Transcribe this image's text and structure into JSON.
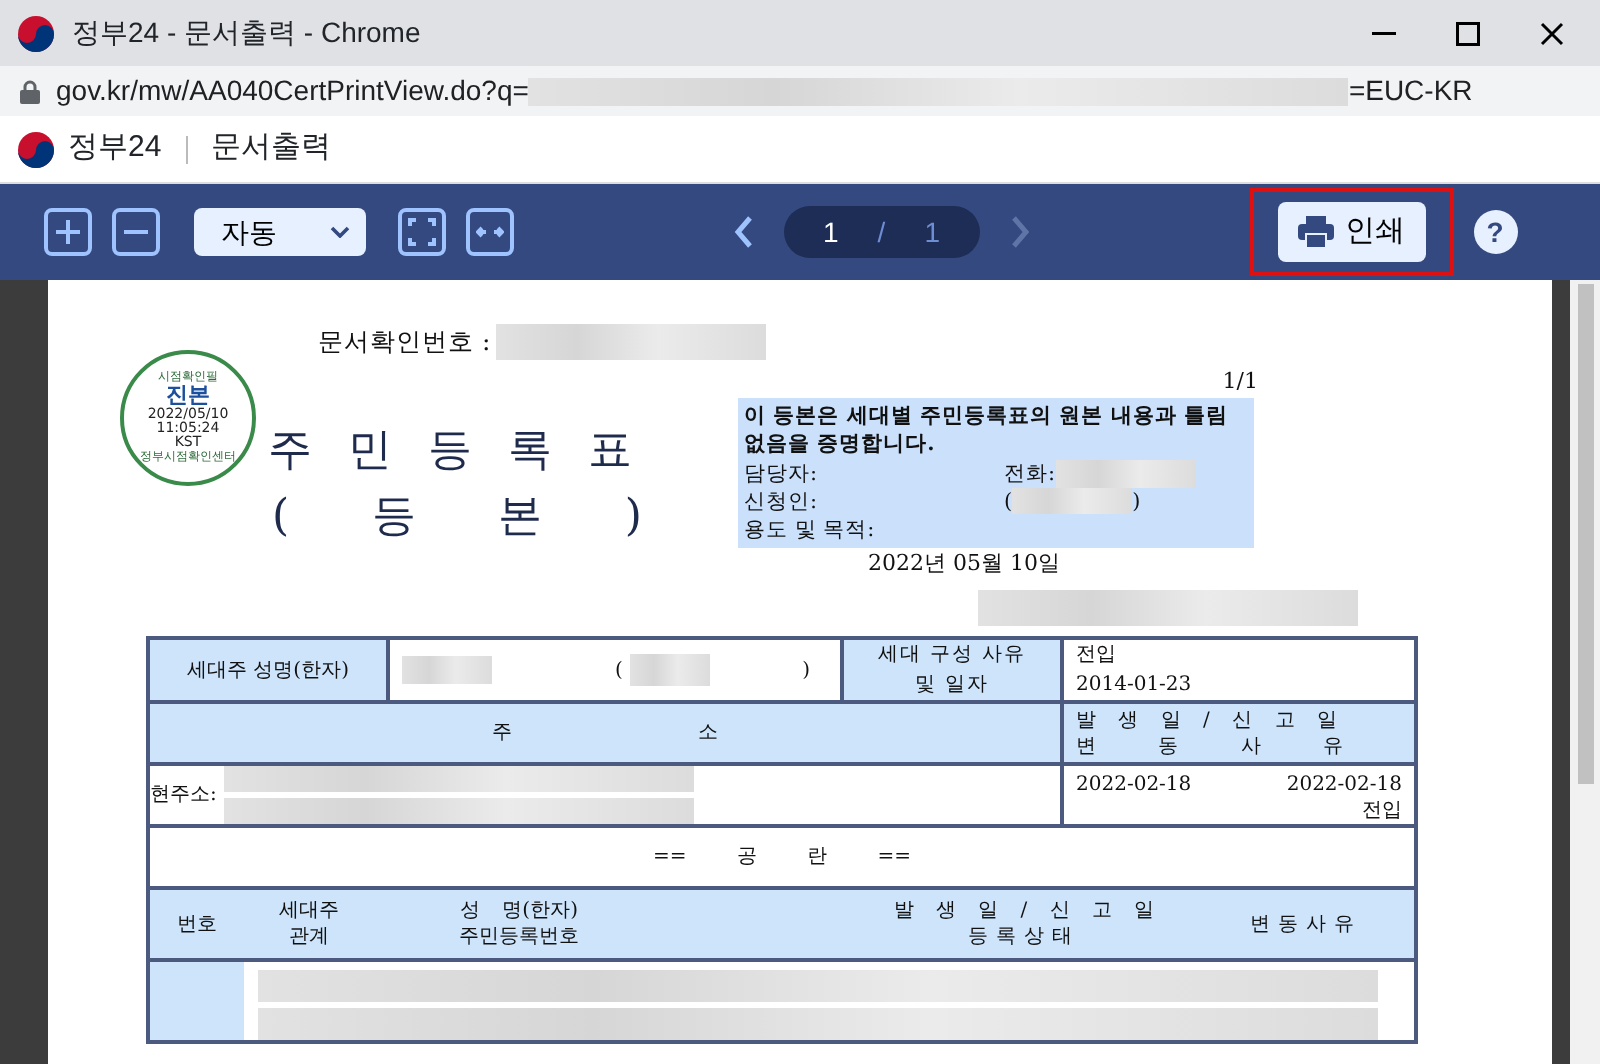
{
  "window": {
    "title": "정부24 - 문서출력 - Chrome"
  },
  "address_bar": {
    "url_start": "gov.kr/mw/AA040CertPrintView.do?q=",
    "url_end": "=EUC-KR"
  },
  "app_header": {
    "brand": "정부24",
    "title": "문서출력"
  },
  "toolbar": {
    "zoom_mode": "자동",
    "page_current": "1",
    "page_separator": "/",
    "page_total": "1",
    "prev_disabled": false,
    "next_disabled": true,
    "print_label": "인쇄",
    "print_highlighted": true,
    "help_label": "?"
  },
  "document": {
    "stamp": {
      "top": "시점확인필",
      "main": "진본",
      "date": "2022/05/10",
      "time": "11:05:24",
      "zone": "KST",
      "bottom": "정부시점확인센터"
    },
    "doc_number_label": "문서확인번호 :",
    "page_label": "1/1",
    "title": "주민등록표",
    "subtitle": [
      "(",
      "등",
      "본",
      ")"
    ],
    "certificate": {
      "statement": "이 등본은 세대별 주민등록표의 원본 내용과 틀림없음을 증명합니다.",
      "officer_label": "담당자:",
      "phone_label": "전화:",
      "applicant_label": "신청인:",
      "applicant_open": "(",
      "applicant_close": ")",
      "purpose_label": "용도 및 목적:"
    },
    "issue_date": "2022년 05월 10일",
    "head_row": {
      "holder_label": "세대주 성명(한자)",
      "name_open": "(",
      "name_close": ")",
      "composition_label": "세대 구성 사유 및 일자",
      "composition_reason": "전입",
      "composition_date": "2014-01-23"
    },
    "address_header": {
      "label": "주 소",
      "dates_label": "발 생 일 / 신 고 일",
      "reason_label": "변 동 사 유"
    },
    "address_row": {
      "label": "현주소:",
      "occurred": "2022-02-18",
      "reported": "2022-02-18",
      "reason": "전입"
    },
    "blank_label": "== 공 란 ==",
    "members_header": {
      "number": "번호",
      "relation": "세대주 관계",
      "name": "성 명(한자)",
      "id": "주민등록번호",
      "dates": "발 생 일 / 신 고 일",
      "status": "등록상태",
      "reason": "변동사유"
    }
  }
}
